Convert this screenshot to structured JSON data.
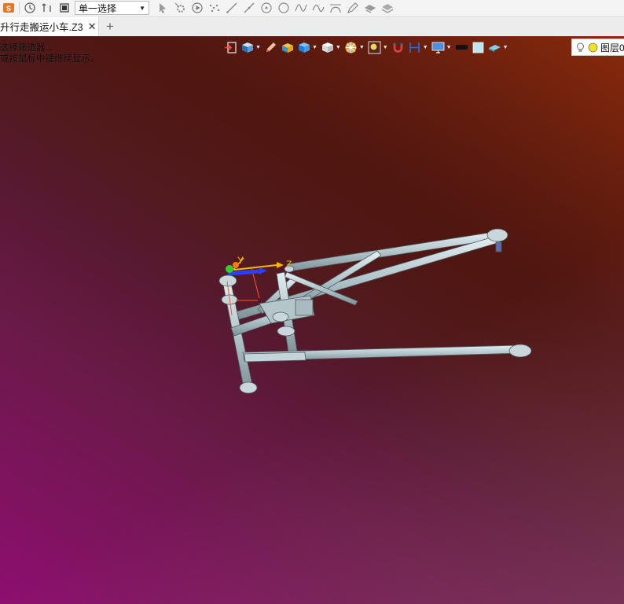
{
  "toolbar": {
    "selection_mode": "单一选择",
    "icons": [
      "app-logo-icon",
      "pick-filter-icon",
      "undo-pick-icon",
      "stop-icon",
      "pointer-icon",
      "gear-pick-icon",
      "play-icon",
      "points-icon",
      "line-icon",
      "line2-icon",
      "circle-point-icon",
      "circle-icon",
      "spline-icon",
      "curve-icon",
      "arc-icon",
      "pen-icon",
      "layers-icon",
      "stack-icon"
    ]
  },
  "tabs": [
    {
      "label": "升行走搬运小车.Z3",
      "active": true
    }
  ],
  "add_tab_label": "+",
  "close_label": "✕",
  "viewport": {
    "message_line1": "选择筛选器...",
    "message_line2": "或按鼠标中键继续显示。",
    "axis_labels": {
      "y": "Y",
      "z": "Z"
    },
    "layer_label": "图层0"
  },
  "viewbar_icons": [
    "exit-icon",
    "view-orient-icon",
    "pencil-icon",
    "shaded-box-icon",
    "blue-cube-icon",
    "white-cube-icon",
    "render-style-icon",
    "zoom-fit-icon",
    "magnet-icon",
    "section-icon",
    "display-monitor-icon",
    "black-rect-icon",
    "light-blue-square-icon",
    "plane-icon"
  ],
  "colors": {
    "model": "#b7c8cc",
    "viewport_dark": "#100505",
    "viewport_magenta": "#8e0e70",
    "viewport_orange": "#8a2a0c"
  }
}
